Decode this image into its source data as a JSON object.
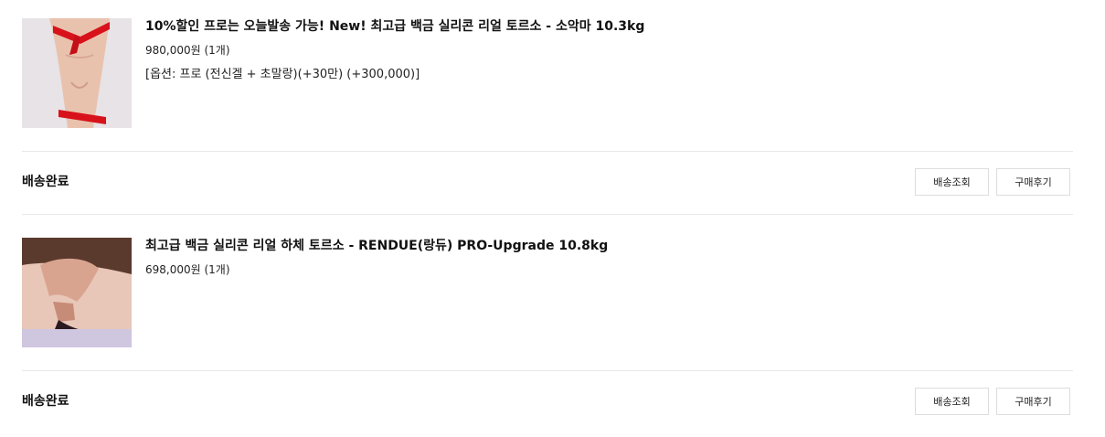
{
  "orders": [
    {
      "product_name": "10%할인 프로는 오늘발송 가능! New! 최고급 백금 실리콘 리얼 토르소 - 소악마 10.3kg",
      "price_qty": "980,000원 (1개)",
      "option": "[옵션: 프로 (전신겔 + 초말랑)(+30만) (+300,000)]",
      "status": "배송완료",
      "track_button": "배송조회",
      "review_button": "구매후기"
    },
    {
      "product_name": "최고급 백금 실리콘 리얼 하체 토르소 - RENDUE(랑듀) PRO-Upgrade 10.8kg",
      "price_qty": "698,000원 (1개)",
      "status": "배송완료",
      "track_button": "배송조회",
      "review_button": "구매후기"
    }
  ],
  "colors": {
    "divider": "#e8e8e8",
    "button_border": "#dddddd",
    "text": "#111111"
  }
}
